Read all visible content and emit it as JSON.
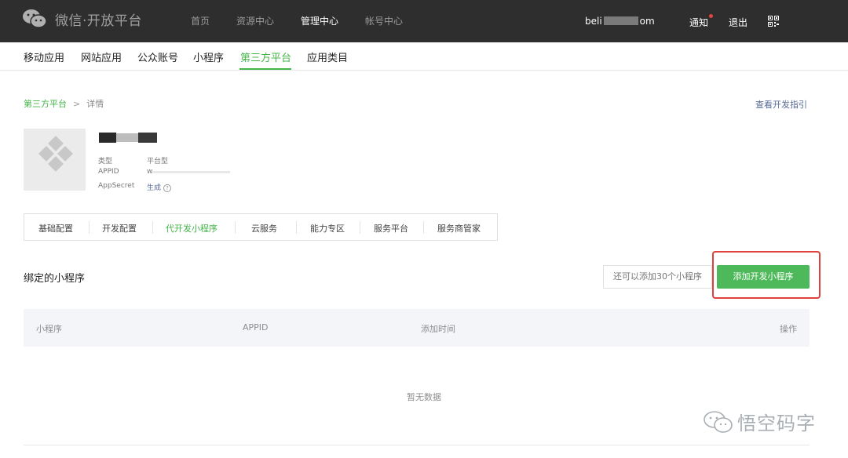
{
  "header": {
    "logo_text": "微信·开放平台",
    "nav": [
      "首页",
      "资源中心",
      "管理中心",
      "帐号中心"
    ],
    "active_nav": 2,
    "account_prefix": "beli",
    "account_suffix": "om",
    "notice_label": "通知",
    "logout_label": "退出",
    "qr_icon": "qrcode-icon"
  },
  "subnav": {
    "items": [
      "移动应用",
      "网站应用",
      "公众账号",
      "小程序",
      "第三方平台",
      "应用类目"
    ],
    "active_index": 4
  },
  "breadcrumb": {
    "parent": "第三方平台",
    "separator": ">",
    "current": "详情"
  },
  "guide_link": "查看开发指引",
  "platform": {
    "type_label": "类型",
    "type_value": "平台型",
    "appid_label": "APPID",
    "appid_value_prefix": "w",
    "secret_label": "AppSecret",
    "secret_action": "生成",
    "help_icon": "?"
  },
  "tabs": {
    "items": [
      "基础配置",
      "开发配置",
      "代开发小程序",
      "云服务",
      "能力专区",
      "服务平台",
      "服务商管家"
    ],
    "active_index": 2
  },
  "bound": {
    "title": "绑定的小程序",
    "remaining": "还可以添加30个小程序",
    "add_button": "添加开发小程序"
  },
  "table": {
    "columns": [
      "小程序",
      "APPID",
      "添加时间",
      "操作"
    ],
    "empty_text": "暂无数据"
  },
  "watermark": {
    "text": "悟空码字"
  },
  "colors": {
    "accent": "#44b549",
    "button": "#4eb95a",
    "link": "#576b95",
    "highlight": "#e0413c",
    "topbar": "#2e2e2e"
  }
}
